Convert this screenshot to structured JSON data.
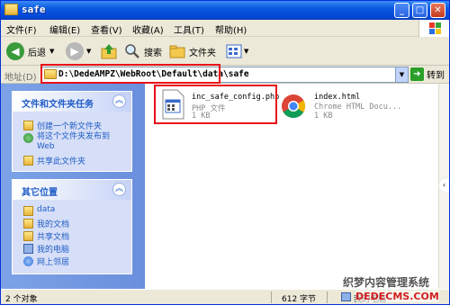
{
  "window": {
    "title": "safe"
  },
  "menu": [
    "文件(F)",
    "编辑(E)",
    "查看(V)",
    "收藏(A)",
    "工具(T)",
    "帮助(H)"
  ],
  "toolbar": {
    "back": "后退",
    "search": "搜索",
    "folders": "文件夹"
  },
  "address": {
    "label": "地址(D)",
    "path": "D:\\DedeAMPZ\\WebRoot\\Default\\data\\safe",
    "go": "转到"
  },
  "tasks_panel": {
    "title": "文件和文件夹任务",
    "items": [
      "创建一个新文件夹",
      "将这个文件夹发布到 Web",
      "共享此文件夹"
    ]
  },
  "places_panel": {
    "title": "其它位置",
    "items": [
      "data",
      "我的文档",
      "共享文档",
      "我的电脑",
      "网上邻居"
    ]
  },
  "files": [
    {
      "name": "inc_safe_config.php",
      "type": "PHP 文件",
      "size": "1 KB"
    },
    {
      "name": "index.html",
      "type": "Chrome HTML Docu...",
      "size": "1 KB"
    }
  ],
  "status": {
    "objects": "2 个对象",
    "size": "612 字节",
    "location": "我的电脑"
  },
  "watermark": {
    "line1": "织梦内容管理系统",
    "line2": "DEDECMS.COM"
  },
  "colors": {
    "accent": "#215dc6",
    "highlight": "#e8101a"
  }
}
